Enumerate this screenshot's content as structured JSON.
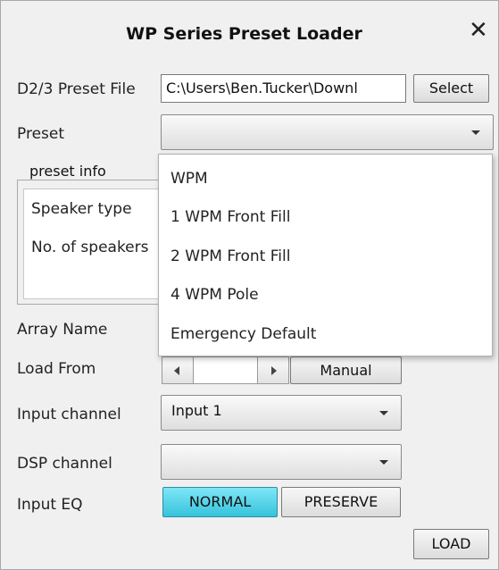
{
  "dialog": {
    "title": "WP Series Preset Loader",
    "close_glyph": "✕"
  },
  "file": {
    "label": "D2/3 Preset File",
    "value": "C:\\Users\\Ben.Tucker\\Downl",
    "select_label": "Select"
  },
  "preset": {
    "label": "Preset",
    "value": "",
    "options": [
      "WPM",
      "1 WPM Front Fill",
      "2 WPM Front Fill",
      "4 WPM Pole",
      "Emergency Default"
    ]
  },
  "preset_info": {
    "title": "preset info",
    "speaker_type_label": "Speaker type",
    "speaker_count_label": "No. of speakers"
  },
  "array_name": {
    "label": "Array Name"
  },
  "load_from": {
    "label": "Load From",
    "manual_label": "Manual"
  },
  "input_channel": {
    "label": "Input channel",
    "value": "Input 1"
  },
  "dsp_channel": {
    "label": "DSP channel",
    "value": ""
  },
  "input_eq": {
    "label": "Input EQ",
    "normal_label": "NORMAL",
    "preserve_label": "PRESERVE",
    "active": "NORMAL"
  },
  "load_label": "LOAD",
  "colors": {
    "active_eq": "#35c3dc",
    "background": "#f0f0f0"
  }
}
